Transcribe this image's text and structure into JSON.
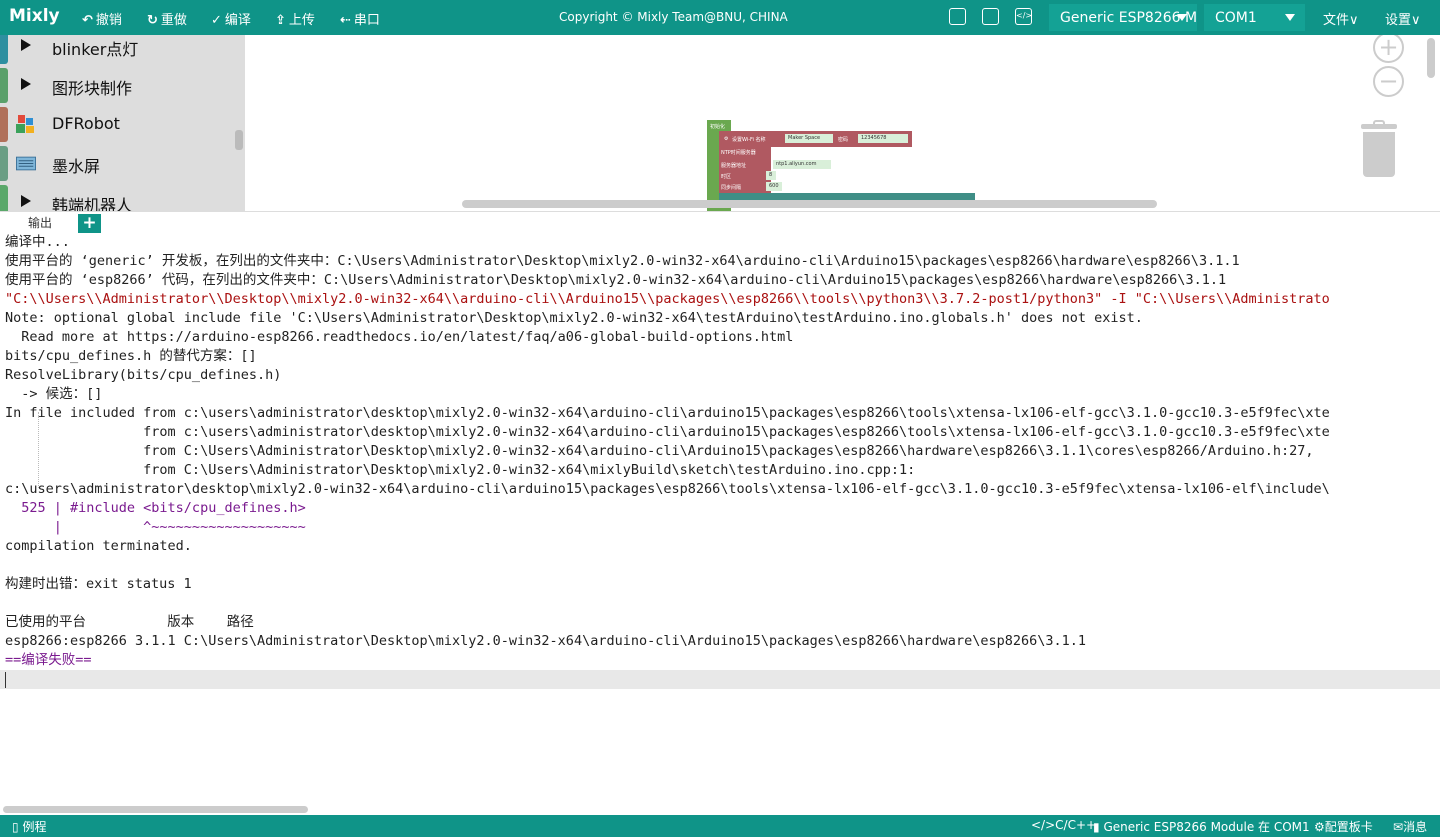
{
  "app": {
    "name": "Mixly",
    "copyright": "Copyright © Mixly Team@BNU, CHINA"
  },
  "toolbar": {
    "undo": "撤销",
    "redo": "重做",
    "compile": "编译",
    "upload": "上传",
    "serial": "串口"
  },
  "board_select": {
    "value": "Generic ESP8266 Module"
  },
  "port_select": {
    "value": "COM1"
  },
  "menus": {
    "file": "文件",
    "settings": "设置"
  },
  "sidebar": {
    "items": [
      {
        "label": "blinker点灯",
        "color": "#2e8fa0"
      },
      {
        "label": "图形块制作",
        "color": "#5aa06a"
      },
      {
        "label": "DFRobot",
        "color": "#b0705a"
      },
      {
        "label": "墨水屏",
        "color": "#6a9e84"
      },
      {
        "label": "韩端机器人",
        "color": "#5aa86a"
      }
    ]
  },
  "workspace": {
    "blocks": {
      "init_label": "初始化",
      "wifi_label": "设置Wi-Fi 名称",
      "wifi_name": "Maker Space",
      "password_label": "密码",
      "password_value": "12345678",
      "ntp_label": "NTP时间服务器",
      "server_label": "服务器地址",
      "server_value": "ntp1.aliyun.com",
      "timezone_label": "时区",
      "timezone_value": "8",
      "sync_label": "同步间隔",
      "sync_value": "600"
    }
  },
  "output_tabs": {
    "output": "输出",
    "add": "+"
  },
  "console": {
    "l1": "编译中...",
    "l2": "使用平台的 ‘generic’ 开发板，在列出的文件夹中：C:\\Users\\Administrator\\Desktop\\mixly2.0-win32-x64\\arduino-cli\\Arduino15\\packages\\esp8266\\hardware\\esp8266\\3.1.1",
    "l3": "使用平台的 ‘esp8266’ 代码，在列出的文件夹中：C:\\Users\\Administrator\\Desktop\\mixly2.0-win32-x64\\arduino-cli\\Arduino15\\packages\\esp8266\\hardware\\esp8266\\3.1.1",
    "l4": "\"C:\\\\Users\\\\Administrator\\\\Desktop\\\\mixly2.0-win32-x64\\\\arduino-cli\\\\Arduino15\\\\packages\\\\esp8266\\\\tools\\\\python3\\\\3.7.2-post1/python3\" -I \"C:\\\\Users\\\\Administrato",
    "l5": "Note: optional global include file 'C:\\Users\\Administrator\\Desktop\\mixly2.0-win32-x64\\testArduino\\testArduino.ino.globals.h' does not exist.",
    "l6": "  Read more at https://arduino-esp8266.readthedocs.io/en/latest/faq/a06-global-build-options.html",
    "l7": "bits/cpu_defines.h 的替代方案：[]",
    "l8": "ResolveLibrary(bits/cpu_defines.h)",
    "l9": "  -> 候选：[]",
    "l10": "In file included from c:\\users\\administrator\\desktop\\mixly2.0-win32-x64\\arduino-cli\\arduino15\\packages\\esp8266\\tools\\xtensa-lx106-elf-gcc\\3.1.0-gcc10.3-e5f9fec\\xte",
    "l11": "                 from c:\\users\\administrator\\desktop\\mixly2.0-win32-x64\\arduino-cli\\arduino15\\packages\\esp8266\\tools\\xtensa-lx106-elf-gcc\\3.1.0-gcc10.3-e5f9fec\\xte",
    "l12": "                 from C:\\Users\\Administrator\\Desktop\\mixly2.0-win32-x64\\arduino-cli\\Arduino15\\packages\\esp8266\\hardware\\esp8266\\3.1.1\\cores\\esp8266/Arduino.h:27,",
    "l13": "                 from C:\\Users\\Administrator\\Desktop\\mixly2.0-win32-x64\\mixlyBuild\\sketch\\testArduino.ino.cpp:1:",
    "l14": "c:\\users\\administrator\\desktop\\mixly2.0-win32-x64\\arduino-cli\\arduino15\\packages\\esp8266\\tools\\xtensa-lx106-elf-gcc\\3.1.0-gcc10.3-e5f9fec\\xtensa-lx106-elf\\include\\",
    "l15": "  525 | #include <bits/cpu_defines.h>",
    "l16": "      |          ^~~~~~~~~~~~~~~~~~~~",
    "l17": "compilation terminated.",
    "l18": "构建时出错：exit status 1",
    "l19": "已使用的平台          版本    路径",
    "l20": "esp8266:esp8266 3.1.1 C:\\Users\\Administrator\\Desktop\\mixly2.0-win32-x64\\arduino-cli\\Arduino15\\packages\\esp8266\\hardware\\esp8266\\3.1.1",
    "l21": "==编译失败=="
  },
  "statusbar": {
    "examples": "例程",
    "language": "C/C++",
    "board_status": "Generic ESP8266 Module 在 COM1",
    "config": "配置板卡",
    "messages": "消息"
  }
}
